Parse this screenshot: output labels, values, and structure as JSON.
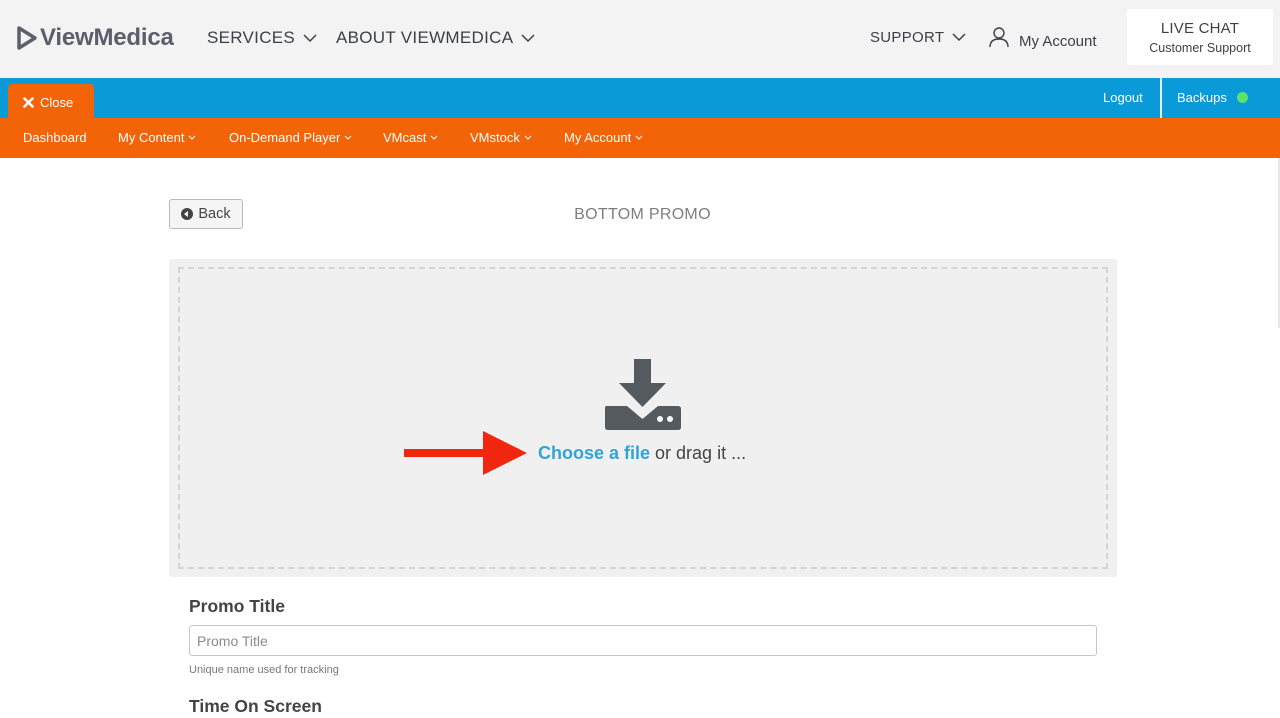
{
  "header": {
    "logo_text": "ViewMedica",
    "nav": [
      {
        "label": "SERVICES"
      },
      {
        "label": "ABOUT VIEWMEDICA"
      }
    ],
    "support_label": "SUPPORT",
    "account_label": "My Account",
    "live_chat": {
      "title": "LIVE CHAT",
      "subtitle": "Customer Support"
    }
  },
  "top_bar": {
    "close_label": "Close",
    "logout_label": "Logout",
    "backups_label": "Backups",
    "backups_status_color": "#5be36b"
  },
  "sub_nav": [
    {
      "label": "Dashboard",
      "has_dropdown": false
    },
    {
      "label": "My Content",
      "has_dropdown": true
    },
    {
      "label": "On-Demand Player",
      "has_dropdown": true
    },
    {
      "label": "VMcast",
      "has_dropdown": true
    },
    {
      "label": "VMstock",
      "has_dropdown": true
    },
    {
      "label": "My Account",
      "has_dropdown": true
    }
  ],
  "page": {
    "back_label": "Back",
    "title": "BOTTOM PROMO"
  },
  "upload": {
    "choose_link": "Choose a file",
    "drag_text": " or drag it ..."
  },
  "form": {
    "promo_title_label": "Promo Title",
    "promo_title_placeholder": "Promo Title",
    "promo_title_value": "",
    "promo_title_help": "Unique name used for tracking",
    "time_on_screen_label": "Time On Screen"
  },
  "colors": {
    "blue_bar": "#0a9ad8",
    "orange": "#f36409",
    "link": "#30a5d5",
    "annotation_arrow": "#f2260f"
  },
  "icons": {
    "logo": "play-triangle-icon",
    "account": "user-icon",
    "close": "close-x-icon",
    "back": "chevron-left-circle-icon",
    "upload": "download-tray-icon",
    "annotation": "red-arrow-icon"
  }
}
